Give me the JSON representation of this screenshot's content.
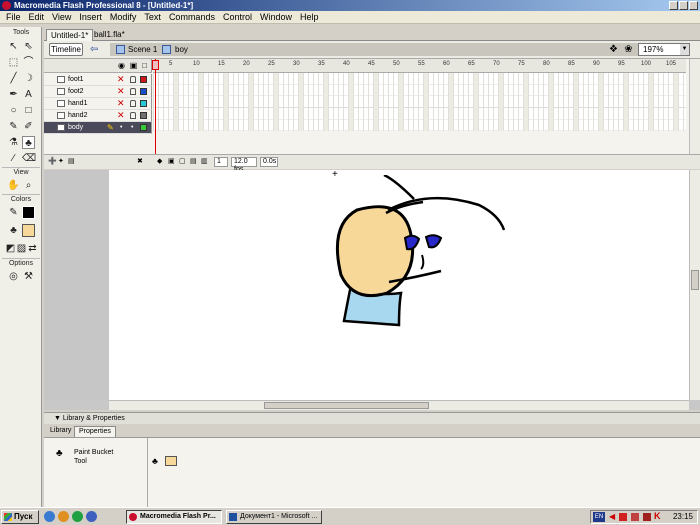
{
  "window": {
    "title": "Macromedia Flash Professional 8 - [Untitled-1*]"
  },
  "menu": [
    "File",
    "Edit",
    "View",
    "Insert",
    "Modify",
    "Text",
    "Commands",
    "Control",
    "Window",
    "Help"
  ],
  "tools_panel": {
    "tools_label": "Tools",
    "view_label": "View",
    "colors_label": "Colors",
    "options_label": "Options"
  },
  "doc_tabs": [
    "Untitled-1*",
    "ball1.fla*"
  ],
  "edit_bar": {
    "timeline_label": "Timeline",
    "scene": "Scene 1",
    "symbol": "boy",
    "zoom": "197%"
  },
  "timeline": {
    "layers": [
      {
        "name": "foot1",
        "color": "#d01818",
        "selected": false
      },
      {
        "name": "foot2",
        "color": "#1a4fd0",
        "selected": false
      },
      {
        "name": "hand1",
        "color": "#28c8d8",
        "selected": false
      },
      {
        "name": "hand2",
        "color": "#707070",
        "selected": false
      },
      {
        "name": "body",
        "color": "#38c838",
        "selected": true
      }
    ],
    "ruler_ticks": [
      "5",
      "10",
      "15",
      "20",
      "25",
      "30",
      "35",
      "40",
      "45",
      "50",
      "55",
      "60",
      "65",
      "70",
      "75",
      "80",
      "85",
      "90",
      "95",
      "100",
      "105"
    ],
    "current_frame": "1",
    "fps": "12.0 fps",
    "elapsed": "0.0s"
  },
  "properties": {
    "header": "Library & Properties",
    "tabs": [
      "Library",
      "Properties"
    ],
    "tool_name": "Paint Bucket\nTool"
  },
  "taskbar": {
    "start": "Пуск",
    "tasks": [
      "Macromedia Flash Pr...",
      "Документ1 - Microsoft ..."
    ],
    "lang": "EN",
    "clock": "23:15"
  },
  "colors": {
    "layer_selected_bg": "#4a4a5a",
    "title_gradient": "#0a246a",
    "face_fill": "#f8d898",
    "shirt_fill": "#a8d8f0",
    "eye_fill": "#2828c8"
  }
}
